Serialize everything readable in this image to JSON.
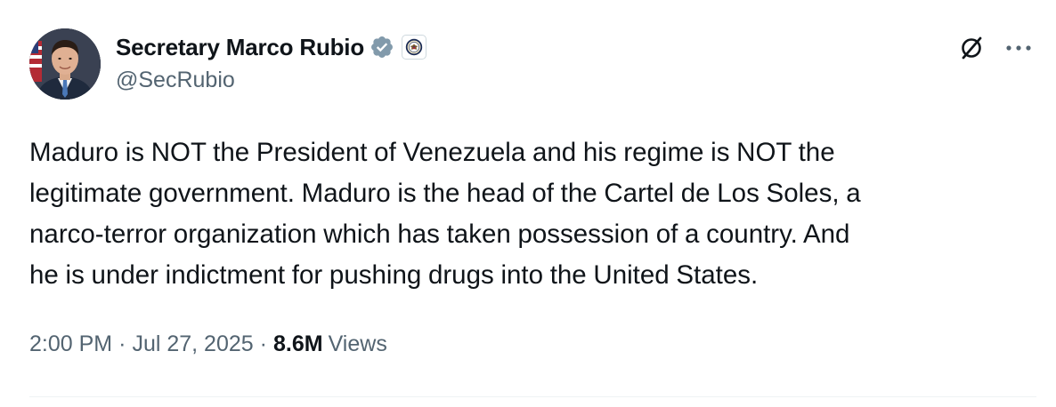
{
  "author": {
    "display_name": "Secretary Marco Rubio",
    "handle": "@SecRubio",
    "verified_badge_color": "#829aab",
    "avatar_icon": "profile-photo",
    "affiliate_icon": "state-department-seal"
  },
  "actions": {
    "grok_icon": "grok-icon",
    "more_icon": "more-horizontal-icon"
  },
  "tweet": {
    "text": "Maduro is NOT the President of Venezuela and his regime is NOT the\nlegitimate government.  Maduro is the head of the Cartel de Los Soles, a\nnarco-terror organization which has taken possession of a country.  And\nhe is under indictment for pushing drugs into the United States."
  },
  "meta": {
    "time": "2:00 PM",
    "separator": "·",
    "date": "Jul 27, 2025",
    "views_count": "8.6M",
    "views_label": "Views"
  },
  "colors": {
    "text_primary": "#0f1419",
    "text_secondary": "#536471",
    "divider": "#eff3f4"
  }
}
